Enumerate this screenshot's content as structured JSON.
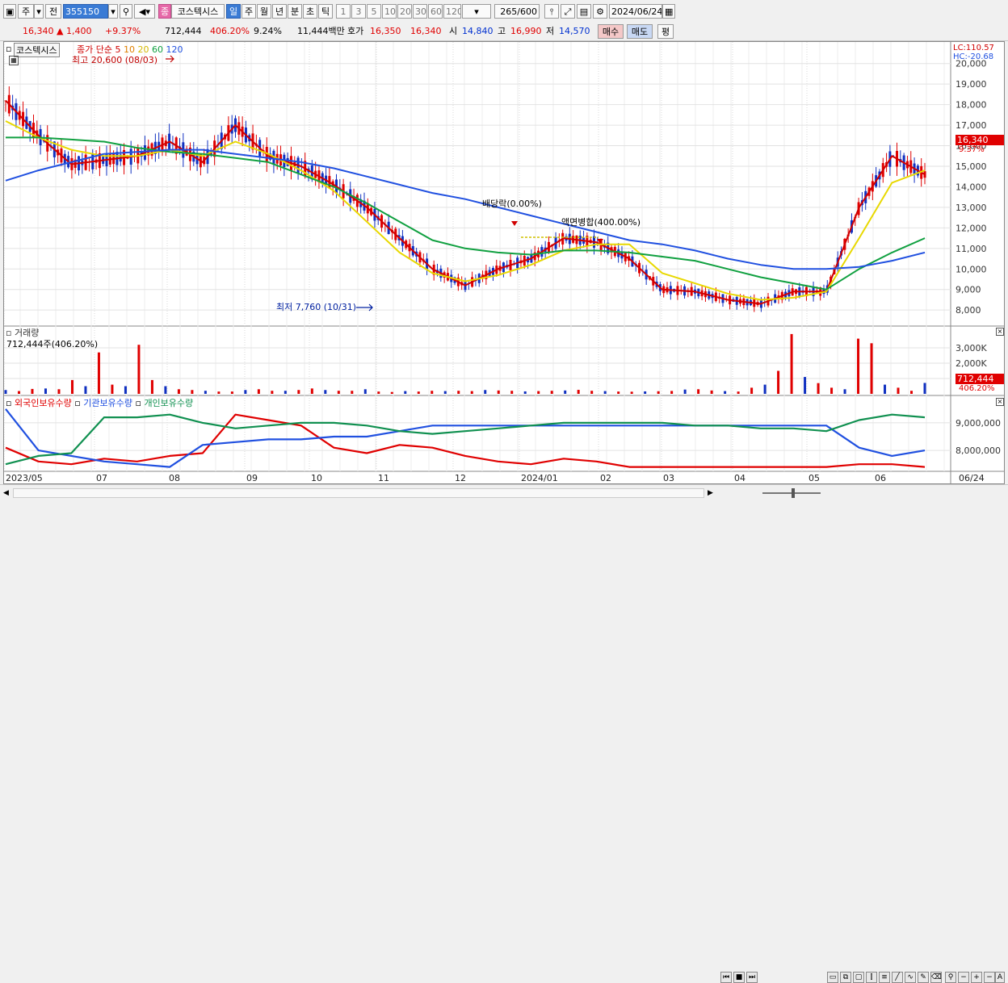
{
  "toolbar": {
    "mode_a": "주",
    "mode_b": "전",
    "code": "355150",
    "name": "코스텍시스",
    "badge": "종",
    "periods": [
      "일",
      "주",
      "월",
      "년",
      "분",
      "초",
      "틱"
    ],
    "numbers": [
      "1",
      "3",
      "5",
      "10",
      "20",
      "30",
      "60",
      "120"
    ],
    "count": "265",
    "count_total": "/600",
    "date": "2024/06/24"
  },
  "info": {
    "price": "16,340",
    "arrow": "▲",
    "change": "1,400",
    "change_pct": "+9.37%",
    "volume": "712,444",
    "volume_pct": "406.20%",
    "turnover": "9.24%",
    "amount": "11,444백만",
    "bid_label": "호가",
    "bid": "16,350",
    "ask": "16,340",
    "open_label": "시",
    "open": "14,840",
    "high_label": "고",
    "high": "16,990",
    "low_label": "저",
    "low": "14,570",
    "buy_label": "매수",
    "sell_label": "매도",
    "avg_label": "평"
  },
  "price_panel": {
    "name": "코스텍시스",
    "ma_label": "종가 단순",
    "ma_periods": [
      "5",
      "10",
      "20",
      "60",
      "120"
    ],
    "ma_colors": [
      "#d00000",
      "#e08000",
      "#e8d800",
      "#10a040",
      "#2050e0"
    ],
    "lc": "LC:110.57",
    "hc": "HC:-20.68",
    "current_price_label": "16,340",
    "current_pct_label": "9.37%",
    "high_note": "최고 20,600 (08/03)",
    "low_note": "최저 7,760 (10/31)",
    "dividend_note": "배당락(0.00%)",
    "split_note": "액면병합(400.00%)"
  },
  "volume_panel": {
    "title": "거래량",
    "info": "712,444주(406.20%)",
    "current_label": "712,444",
    "current_pct": "406.20%"
  },
  "holding_panel": {
    "series": [
      "외국인보유수량",
      "기관보유수량",
      "개인보유수량"
    ],
    "colors": [
      "#e00000",
      "#2050e0",
      "#109050"
    ]
  },
  "x_labels": [
    "2023/05",
    "07",
    "08",
    "09",
    "10",
    "11",
    "12",
    "2024/01",
    "02",
    "03",
    "04",
    "05",
    "06",
    "06/24"
  ],
  "chart_data": [
    {
      "type": "line",
      "title": "코스텍시스",
      "ylim": [
        7300,
        20500
      ],
      "y_ticks": [
        "8,000",
        "9,000",
        "10,000",
        "11,000",
        "12,000",
        "13,000",
        "14,000",
        "15,000",
        "16,000",
        "17,000",
        "18,000",
        "19,000",
        "20,000"
      ],
      "y_tick_values": [
        8000,
        9000,
        10000,
        11000,
        12000,
        13000,
        14000,
        15000,
        16000,
        17000,
        18000,
        19000,
        20000
      ],
      "x_periods": [
        "2023/05",
        "07",
        "08",
        "09",
        "10",
        "11",
        "12",
        "2024/01",
        "02",
        "03",
        "04",
        "05",
        "06"
      ],
      "series": [
        {
          "name": "5",
          "values": [
            18200,
            16500,
            15100,
            15300,
            15500,
            16200,
            15200,
            17000,
            15500,
            15000,
            14100,
            13000,
            11500,
            10000,
            9200,
            10000,
            10500,
            11500,
            11300,
            10500,
            9000,
            8900,
            8500,
            8300,
            8900,
            8900,
            13000,
            15500,
            14600
          ]
        },
        {
          "name": "20",
          "values": [
            17200,
            16400,
            15800,
            15500,
            15500,
            15800,
            15500,
            16200,
            15600,
            14800,
            13800,
            12300,
            10800,
            9800,
            9400,
            9700,
            10200,
            10900,
            11200,
            11200,
            9800,
            9300,
            8800,
            8500,
            8600,
            8900,
            11500,
            14200,
            14800
          ]
        },
        {
          "name": "60",
          "values": [
            16400,
            16400,
            16300,
            16200,
            15900,
            15700,
            15600,
            15400,
            15200,
            14600,
            14000,
            13200,
            12300,
            11400,
            11000,
            10800,
            10700,
            10900,
            10900,
            10800,
            10600,
            10400,
            10000,
            9600,
            9300,
            9000,
            10000,
            10800,
            11500
          ]
        },
        {
          "name": "120",
          "values": [
            14300,
            14800,
            15200,
            15600,
            15700,
            15800,
            15800,
            15600,
            15400,
            15200,
            14900,
            14500,
            14100,
            13700,
            13400,
            13000,
            12600,
            12200,
            11800,
            11400,
            11200,
            10900,
            10500,
            10200,
            10000,
            10000,
            10100,
            10400,
            10800
          ]
        }
      ]
    },
    {
      "type": "bar",
      "title": "거래량",
      "y_ticks": [
        "1,000K",
        "2,000K",
        "3,000K"
      ],
      "y_tick_values": [
        1000,
        2000,
        3000
      ],
      "ylim": [
        0,
        4000
      ],
      "values_k": [
        250,
        180,
        320,
        350,
        300,
        900,
        500,
        2700,
        600,
        500,
        3200,
        900,
        500,
        300,
        250,
        200,
        150,
        150,
        250,
        300,
        200,
        200,
        250,
        350,
        250,
        200,
        200,
        300,
        150,
        120,
        180,
        150,
        200,
        180,
        200,
        180,
        250,
        220,
        200,
        160,
        180,
        200,
        220,
        260,
        200,
        180,
        150,
        140,
        160,
        170,
        190,
        280,
        300,
        220,
        180,
        150,
        400,
        600,
        1500,
        3900,
        1100,
        700,
        400,
        300,
        3600,
        3300,
        600,
        400,
        200,
        712
      ]
    },
    {
      "type": "line",
      "title": "보유수량",
      "y_ticks": [
        "8,000,000",
        "9,000,000"
      ],
      "y_tick_values": [
        8000000,
        9000000
      ],
      "ylim": [
        7300000,
        9700000
      ],
      "series": [
        {
          "name": "외국인보유수량",
          "values": [
            8100000,
            7600000,
            7500000,
            7700000,
            7600000,
            7800000,
            7900000,
            9300000,
            9100000,
            8900000,
            8100000,
            7900000,
            8200000,
            8100000,
            7800000,
            7600000,
            7500000,
            7700000,
            7600000,
            7400000,
            7400000,
            7400000,
            7400000,
            7400000,
            7400000,
            7400000,
            7500000,
            7500000,
            7400000
          ]
        },
        {
          "name": "기관보유수량",
          "values": [
            9500000,
            8000000,
            7800000,
            7600000,
            7500000,
            7400000,
            8200000,
            8300000,
            8400000,
            8400000,
            8500000,
            8500000,
            8700000,
            8900000,
            8900000,
            8900000,
            8900000,
            8900000,
            8900000,
            8900000,
            8900000,
            8900000,
            8900000,
            8900000,
            8900000,
            8900000,
            8100000,
            7800000,
            8000000
          ]
        },
        {
          "name": "개인보유수량",
          "values": [
            7500000,
            7800000,
            7900000,
            9200000,
            9200000,
            9300000,
            9000000,
            8800000,
            8900000,
            9000000,
            9000000,
            8900000,
            8700000,
            8600000,
            8700000,
            8800000,
            8900000,
            9000000,
            9000000,
            9000000,
            9000000,
            8900000,
            8900000,
            8800000,
            8800000,
            8700000,
            9100000,
            9300000,
            9200000
          ]
        }
      ]
    }
  ]
}
